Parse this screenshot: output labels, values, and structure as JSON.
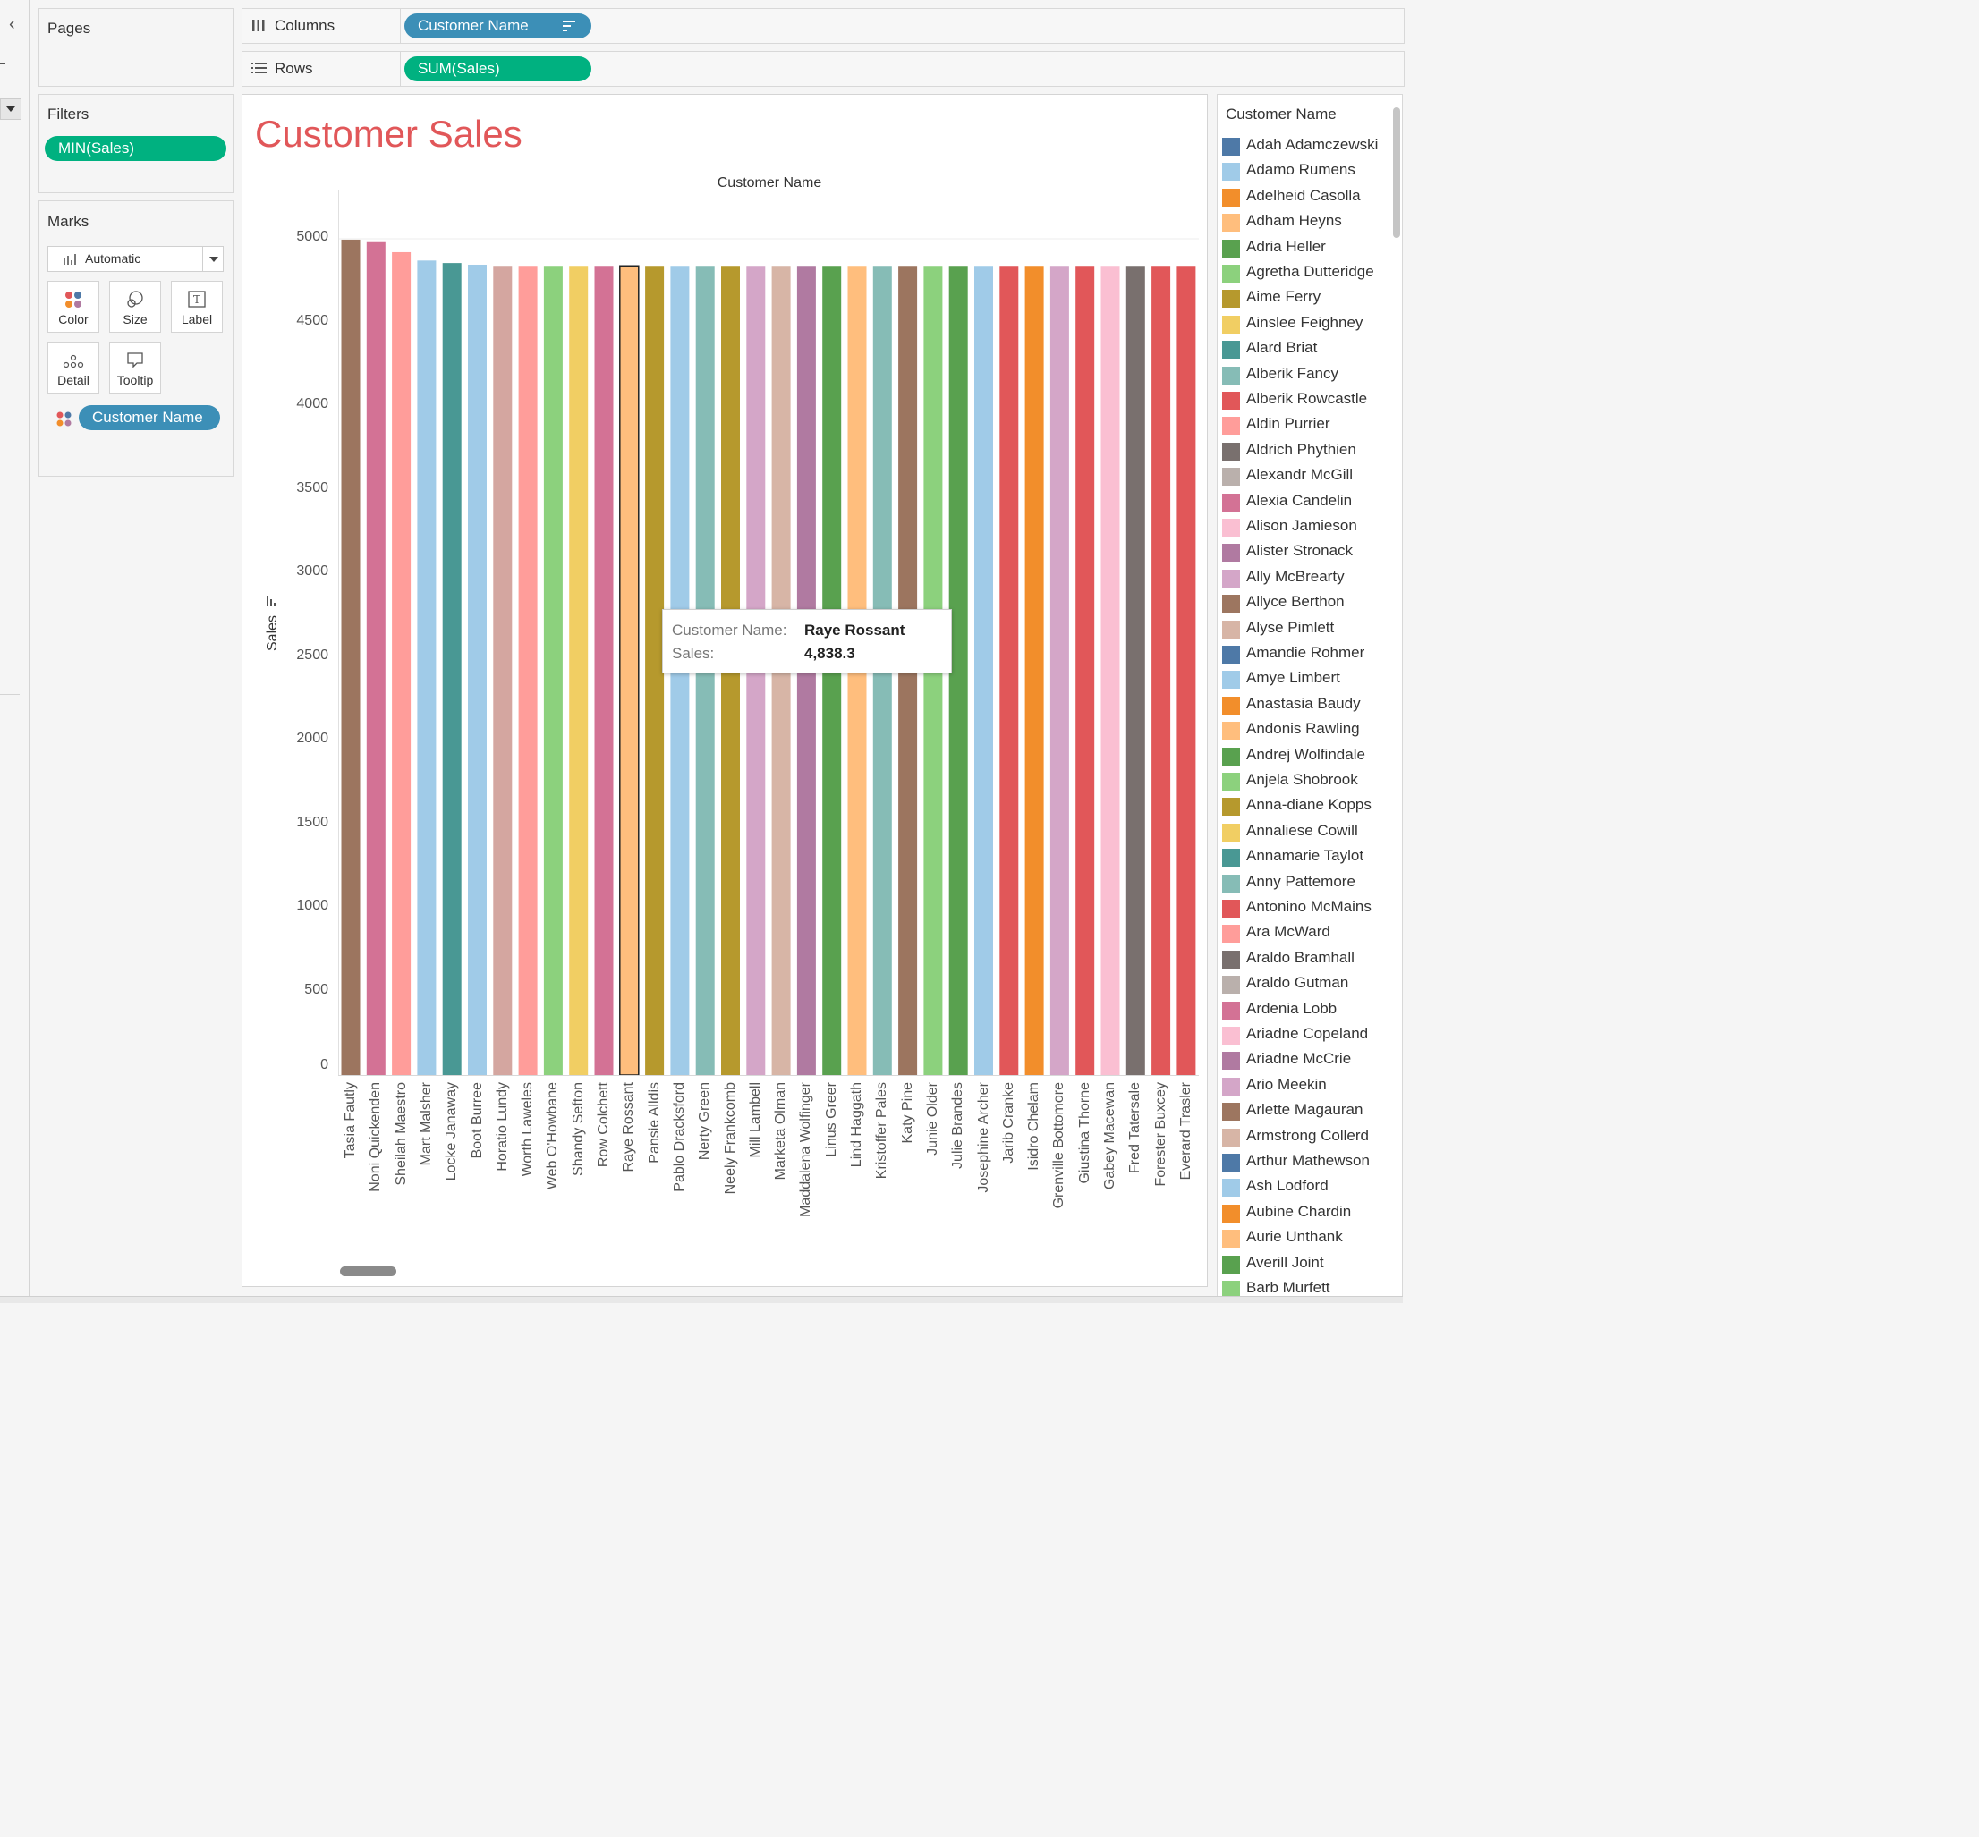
{
  "shelves": {
    "pages_title": "Pages",
    "columns_label": "Columns",
    "columns_pill": "Customer Name",
    "rows_label": "Rows",
    "rows_pill": "SUM(Sales)"
  },
  "filters": {
    "title": "Filters",
    "pill": "MIN(Sales)"
  },
  "marks": {
    "title": "Marks",
    "type": "Automatic",
    "buttons": {
      "color": "Color",
      "size": "Size",
      "label": "Label",
      "detail": "Detail",
      "tooltip": "Tooltip"
    },
    "color_pill": "Customer Name"
  },
  "chart": {
    "title": "Customer Sales",
    "x_header": "Customer Name",
    "y_label": "Sales",
    "title_color": "#e15759"
  },
  "chart_data": {
    "type": "bar",
    "ylim": [
      0,
      5000
    ],
    "yticks": [
      0,
      500,
      1000,
      1500,
      2000,
      2500,
      3000,
      3500,
      4000,
      4500,
      5000
    ],
    "categories": [
      "Tasia Fautly",
      "Noni Quickenden",
      "Sheilah Maestro",
      "Mart Malsher",
      "Locke Janaway",
      "Boot Burree",
      "Horatio Lundy",
      "Worth Laweles",
      "Web O'Howbane",
      "Shandy Sefton",
      "Row Colchett",
      "Raye Rossant",
      "Pansie Alldis",
      "Pablo Dracksford",
      "Nerty Green",
      "Neely Frankcomb",
      "Mill Lambell",
      "Marketa Olman",
      "Maddalena Wolfinger",
      "Linus Greer",
      "Lind Haggath",
      "Kristoffer Pales",
      "Katy Pine",
      "Junie Older",
      "Julie Brandes",
      "Josephine Archer",
      "Jarib Cranke",
      "Isidro Chelam",
      "Grenville Bottomore",
      "Giustina Thorne",
      "Gabey Macewan",
      "Fred Tatersale",
      "Forester Buxcey",
      "Everard Trasler"
    ],
    "values": [
      4995,
      4980,
      4920,
      4870,
      4855,
      4845,
      4838.3,
      4838.3,
      4838.3,
      4838.3,
      4838.3,
      4838.3,
      4838.3,
      4838.3,
      4838.3,
      4838.3,
      4838.3,
      4838.3,
      4838.3,
      4838.3,
      4838.3,
      4838.3,
      4838.3,
      4838.3,
      4838.3,
      4838.3,
      4838.3,
      4838.3,
      4838.3,
      4838.3,
      4838.3,
      4838.3,
      4838.3,
      4838.3
    ],
    "colors": [
      "#9c755f",
      "#d37295",
      "#ff9d9a",
      "#a0cbe8",
      "#499894",
      "#a0cbe8",
      "#d4a6a0",
      "#ff9d9a",
      "#8cd17d",
      "#f1ce63",
      "#d37295",
      "#ffbe7d",
      "#b6992d",
      "#a0cbe8",
      "#86bcb6",
      "#b6992d",
      "#d4a6c8",
      "#d7b5a6",
      "#b07aa1",
      "#59a14f",
      "#ffbe7d",
      "#86bcb6",
      "#9c755f",
      "#8cd17d",
      "#59a14f",
      "#a0cbe8",
      "#e15759",
      "#f28e2b",
      "#d4a6c8",
      "#e15759",
      "#fabfd2",
      "#79706e",
      "#e15759",
      "#e15759"
    ],
    "highlighted": "Raye Rossant"
  },
  "tooltip": {
    "name_key": "Customer Name:",
    "name_val": "Raye Rossant",
    "sales_key": "Sales:",
    "sales_val": "4,838.3"
  },
  "legend": {
    "title": "Customer Name",
    "items": [
      {
        "name": "Adah Adamczewski",
        "color": "#4e79a7"
      },
      {
        "name": "Adamo Rumens",
        "color": "#a0cbe8"
      },
      {
        "name": "Adelheid Casolla",
        "color": "#f28e2b"
      },
      {
        "name": "Adham Heyns",
        "color": "#ffbe7d"
      },
      {
        "name": "Adria Heller",
        "color": "#59a14f"
      },
      {
        "name": "Agretha Dutteridge",
        "color": "#8cd17d"
      },
      {
        "name": "Aime Ferry",
        "color": "#b6992d"
      },
      {
        "name": "Ainslee Feighney",
        "color": "#f1ce63"
      },
      {
        "name": "Alard Briat",
        "color": "#499894"
      },
      {
        "name": "Alberik Fancy",
        "color": "#86bcb6"
      },
      {
        "name": "Alberik Rowcastle",
        "color": "#e15759"
      },
      {
        "name": "Aldin Purrier",
        "color": "#ff9d9a"
      },
      {
        "name": "Aldrich Phythien",
        "color": "#79706e"
      },
      {
        "name": "Alexandr McGill",
        "color": "#bab0ac"
      },
      {
        "name": "Alexia Candelin",
        "color": "#d37295"
      },
      {
        "name": "Alison Jamieson",
        "color": "#fabfd2"
      },
      {
        "name": "Alister Stronack",
        "color": "#b07aa1"
      },
      {
        "name": "Ally McBrearty",
        "color": "#d4a6c8"
      },
      {
        "name": "Allyce Berthon",
        "color": "#9d7660"
      },
      {
        "name": "Alyse Pimlett",
        "color": "#d7b5a6"
      },
      {
        "name": "Amandie Rohmer",
        "color": "#4e79a7"
      },
      {
        "name": "Amye Limbert",
        "color": "#a0cbe8"
      },
      {
        "name": "Anastasia Baudy",
        "color": "#f28e2b"
      },
      {
        "name": "Andonis Rawling",
        "color": "#ffbe7d"
      },
      {
        "name": "Andrej Wolfindale",
        "color": "#59a14f"
      },
      {
        "name": "Anjela Shobrook",
        "color": "#8cd17d"
      },
      {
        "name": "Anna-diane Kopps",
        "color": "#b6992d"
      },
      {
        "name": "Annaliese Cowill",
        "color": "#f1ce63"
      },
      {
        "name": "Annamarie Taylot",
        "color": "#499894"
      },
      {
        "name": "Anny Pattemore",
        "color": "#86bcb6"
      },
      {
        "name": "Antonino McMains",
        "color": "#e15759"
      },
      {
        "name": "Ara McWard",
        "color": "#ff9d9a"
      },
      {
        "name": "Araldo Bramhall",
        "color": "#79706e"
      },
      {
        "name": "Araldo Gutman",
        "color": "#bab0ac"
      },
      {
        "name": "Ardenia Lobb",
        "color": "#d37295"
      },
      {
        "name": "Ariadne Copeland",
        "color": "#fabfd2"
      },
      {
        "name": "Ariadne McCrie",
        "color": "#b07aa1"
      },
      {
        "name": "Ario Meekin",
        "color": "#d4a6c8"
      },
      {
        "name": "Arlette Magauran",
        "color": "#9d7660"
      },
      {
        "name": "Armstrong Collerd",
        "color": "#d7b5a6"
      },
      {
        "name": "Arthur Mathewson",
        "color": "#4e79a7"
      },
      {
        "name": "Ash Lodford",
        "color": "#a0cbe8"
      },
      {
        "name": "Aubine Chardin",
        "color": "#f28e2b"
      },
      {
        "name": "Aurie Unthank",
        "color": "#ffbe7d"
      },
      {
        "name": "Averill Joint",
        "color": "#59a14f"
      },
      {
        "name": "Barb Murfett",
        "color": "#8cd17d"
      }
    ]
  }
}
